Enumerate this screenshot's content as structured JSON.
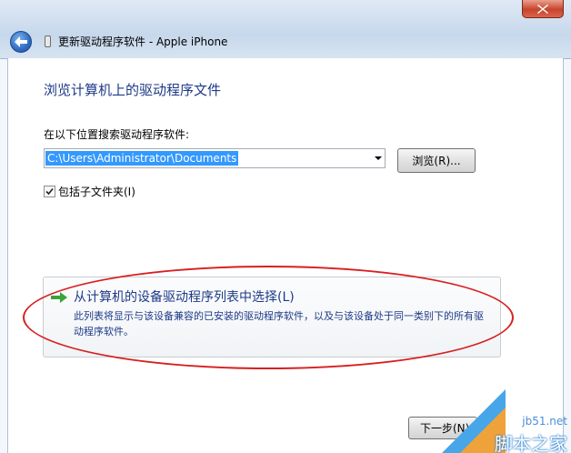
{
  "window": {
    "title": "更新驱动程序软件 - Apple iPhone"
  },
  "main": {
    "heading": "浏览计算机上的驱动程序文件",
    "search_label": "在以下位置搜索驱动程序软件:",
    "path_value": "C:\\Users\\Administrator\\Documents",
    "browse_label": "浏览(R)...",
    "include_subfolders_label": "包括子文件夹(I)",
    "include_subfolders_checked": true,
    "pick_option": {
      "title": "从计算机的设备驱动程序列表中选择(L)",
      "description": "此列表将显示与该设备兼容的已安装的驱动程序软件，以及与该设备处于同一类别下的所有驱动程序软件。"
    },
    "next_label": "下一步(N)"
  },
  "icons": {
    "back": "back-arrow-icon",
    "close": "close-icon",
    "device": "device-icon",
    "pick_arrow": "green-arrow-icon",
    "checkbox_mark": "checkmark-icon"
  },
  "colors": {
    "heading_blue": "#1e3a87",
    "selection_blue": "#3399ff",
    "annotation_red": "#d81f1f",
    "close_red": "#c7442d"
  },
  "watermark": {
    "site": "jb51.net",
    "brand": "脚本之家"
  }
}
